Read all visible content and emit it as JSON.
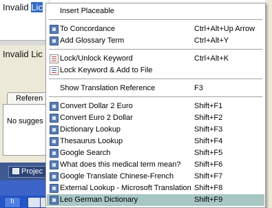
{
  "background": {
    "editor_line_1": {
      "prefix": "Invalid ",
      "highlighted": "Lic"
    },
    "editor_line_2": "Invalid Lic",
    "tab_label": "Referen",
    "panel_text": "No sugges",
    "project_button": "Projec",
    "taskbar": {
      "start_fragment": "tı"
    }
  },
  "menu": {
    "groups": [
      [
        {
          "label": "Insert Placeable",
          "shortcut": "",
          "icon": "none"
        }
      ],
      [
        {
          "label": "To Concordance",
          "shortcut": "Ctrl+Alt+Up Arrow",
          "icon": "concordance-icon"
        },
        {
          "label": "Add Glossary Term",
          "shortcut": "Ctrl+Alt+Y",
          "icon": "glossary-icon"
        }
      ],
      [
        {
          "label": "Lock/Unlock Keyword",
          "shortcut": "Ctrl+Alt+K",
          "icon": "lock-keyword-icon"
        },
        {
          "label": "Lock Keyword & Add to File",
          "shortcut": "",
          "icon": "lock-keyword-file-icon"
        }
      ],
      [
        {
          "label": "Show Translation Reference",
          "shortcut": "F3",
          "icon": "none"
        }
      ],
      [
        {
          "label": "Convert Dollar 2 Euro",
          "shortcut": "Shift+F1",
          "icon": "macro-icon"
        },
        {
          "label": "Convert Euro 2 Dollar",
          "shortcut": "Shift+F2",
          "icon": "macro-icon"
        },
        {
          "label": "Dictionary Lookup",
          "shortcut": "Shift+F3",
          "icon": "macro-icon"
        },
        {
          "label": "Thesaurus Lookup",
          "shortcut": "Shift+F4",
          "icon": "macro-icon"
        },
        {
          "label": "Google Search",
          "shortcut": "Shift+F5",
          "icon": "macro-icon"
        },
        {
          "label": "What does this medical term mean?",
          "shortcut": "Shift+F6",
          "icon": "macro-icon"
        },
        {
          "label": "Google Translate Chinese-French",
          "shortcut": "Shift+F7",
          "icon": "macro-icon"
        },
        {
          "label": "External Lookup - Microsoft Translation",
          "shortcut": "Shift+F8",
          "icon": "macro-icon"
        },
        {
          "label": "Leo German Dictionary",
          "shortcut": "Shift+F9",
          "icon": "macro-icon",
          "selected": true
        }
      ]
    ]
  },
  "colors": {
    "selection": "#a7c7c4",
    "text_highlight": "#316ac5",
    "taskbar": "#2554c6"
  }
}
